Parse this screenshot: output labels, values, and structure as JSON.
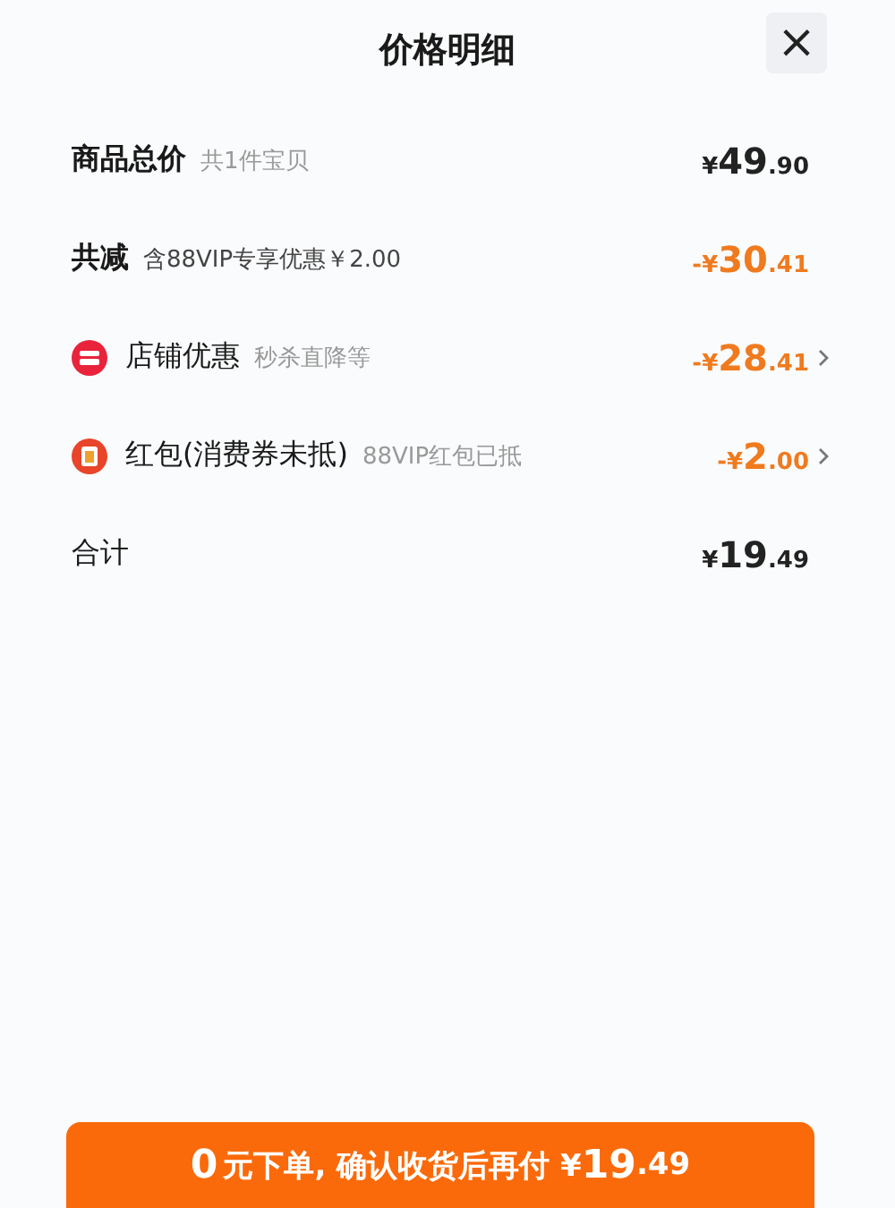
{
  "header": {
    "title": "价格明细",
    "close": "×"
  },
  "rows": [
    {
      "kind": "plain",
      "label": "商品总价",
      "note": "共1件宝贝",
      "amount": {
        "prefix": "¥",
        "major": "49",
        "minor": ".90"
      },
      "discount": false,
      "expandable": false
    },
    {
      "kind": "plain",
      "label": "共减",
      "note": "含88VIP专享优惠￥2.00",
      "amount": {
        "prefix": "-¥",
        "major": "30",
        "minor": ".41"
      },
      "discount": true,
      "expandable": false
    },
    {
      "kind": "shop",
      "label": "店铺优惠",
      "note": "秒杀直降等",
      "amount": {
        "prefix": "-¥",
        "major": "28",
        "minor": ".41"
      },
      "discount": true,
      "expandable": true
    },
    {
      "kind": "redpacket",
      "label": "红包(消费券未抵)",
      "note": "88VIP红包已抵",
      "amount": {
        "prefix": "-¥",
        "major": "2",
        "minor": ".00"
      },
      "discount": true,
      "expandable": true
    },
    {
      "kind": "total",
      "label": "合计",
      "amount": {
        "prefix": "¥",
        "major": "19",
        "minor": ".49"
      },
      "discount": false,
      "expandable": false
    }
  ],
  "action": {
    "lead": "0",
    "text": "元下单, 确认收货后再付 ¥",
    "major": "19",
    "minor": ".49"
  }
}
